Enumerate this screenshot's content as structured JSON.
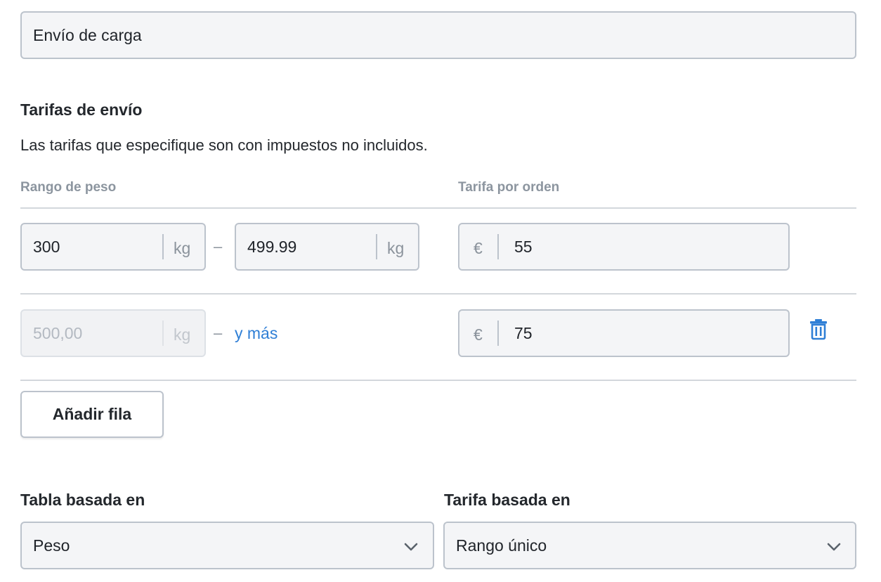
{
  "shipping_name": {
    "value": "Envío de carga"
  },
  "rates": {
    "title": "Tarifas de envío",
    "description": "Las tarifas que especifique son con impuestos no incluidos.",
    "col_weight": "Rango de peso",
    "col_rate": "Tarifa por orden",
    "rows": [
      {
        "from": "300",
        "from_unit": "kg",
        "dash": "–",
        "to": "499.99",
        "to_unit": "kg",
        "currency": "€",
        "rate": "55"
      },
      {
        "from": "500,00",
        "from_unit": "kg",
        "dash": "–",
        "and_more": "y más",
        "currency": "€",
        "rate": "75"
      }
    ],
    "add_row": "Añadir fila"
  },
  "table_based_on": {
    "label": "Tabla basada en",
    "value": "Peso"
  },
  "rate_based_on": {
    "label": "Tarifa basada en",
    "value": "Rango único"
  },
  "colors": {
    "accent": "#2f7fd6",
    "border": "#bcc3cc",
    "field_bg": "#f4f5f7"
  },
  "icons": {
    "delete": "trash-icon",
    "dropdown": "chevron-down-icon"
  }
}
